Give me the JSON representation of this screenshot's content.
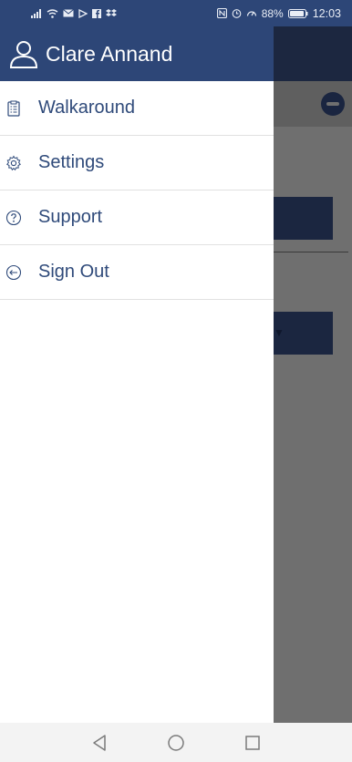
{
  "status_bar": {
    "left_icons": [
      "signal-icon",
      "wifi-icon",
      "mail-icon",
      "play-icon",
      "facebook-icon",
      "dropbox-icon"
    ],
    "right_icons": [
      "nfc-icon",
      "alarm-icon",
      "speed-icon"
    ],
    "battery": "88%",
    "time": "12:03"
  },
  "drawer": {
    "user_name": "Clare Annand",
    "items": [
      {
        "label": "Walkaround",
        "icon": "clipboard-icon"
      },
      {
        "label": "Settings",
        "icon": "gear-icon"
      },
      {
        "label": "Support",
        "icon": "help-icon"
      },
      {
        "label": "Sign Out",
        "icon": "sign-out-icon"
      }
    ]
  },
  "nav_bar": {
    "buttons": [
      "back-icon",
      "home-icon",
      "recents-icon"
    ]
  },
  "colors": {
    "header": "#2d4677",
    "menu_text": "#2f4a7a",
    "scrim": "#6f6f6f",
    "background_buttons": "#1b2640"
  }
}
